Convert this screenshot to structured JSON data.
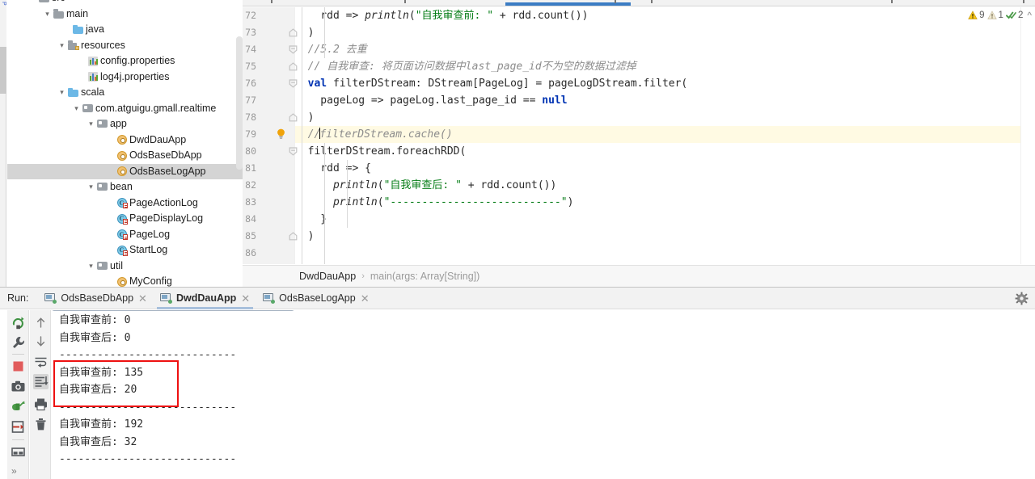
{
  "project_tree": {
    "items": [
      {
        "label": "src",
        "indent": 38,
        "icon": "folder-icon",
        "arrow": "",
        "selected": false,
        "partial": true
      },
      {
        "label": "main",
        "indent": 56,
        "icon": "folder-icon",
        "arrow": "v",
        "selected": false
      },
      {
        "label": "java",
        "indent": 80,
        "icon": "folder-blue-icon",
        "arrow": "",
        "selected": false
      },
      {
        "label": "resources",
        "indent": 74,
        "icon": "resources-folder-icon",
        "arrow": "v",
        "selected": false
      },
      {
        "label": "config.properties",
        "indent": 98,
        "icon": "properties-file-icon",
        "arrow": "",
        "selected": false
      },
      {
        "label": "log4j.properties",
        "indent": 98,
        "icon": "properties-file-icon",
        "arrow": "",
        "selected": false
      },
      {
        "label": "scala",
        "indent": 74,
        "icon": "folder-blue-icon",
        "arrow": "v",
        "selected": false
      },
      {
        "label": "com.atguigu.gmall.realtime",
        "indent": 92,
        "icon": "package-icon",
        "arrow": "v",
        "selected": false
      },
      {
        "label": "app",
        "indent": 110,
        "icon": "package-icon",
        "arrow": "v",
        "selected": false
      },
      {
        "label": "DwdDauApp",
        "indent": 134,
        "icon": "scala-object-icon",
        "arrow": "",
        "selected": false
      },
      {
        "label": "OdsBaseDbApp",
        "indent": 134,
        "icon": "scala-object-icon",
        "arrow": "",
        "selected": false
      },
      {
        "label": "OdsBaseLogApp",
        "indent": 134,
        "icon": "scala-object-icon",
        "arrow": "",
        "selected": true
      },
      {
        "label": "bean",
        "indent": 110,
        "icon": "package-icon",
        "arrow": "v",
        "selected": false
      },
      {
        "label": "PageActionLog",
        "indent": 134,
        "icon": "scala-class-icon",
        "arrow": "",
        "selected": false
      },
      {
        "label": "PageDisplayLog",
        "indent": 134,
        "icon": "scala-class-icon",
        "arrow": "",
        "selected": false
      },
      {
        "label": "PageLog",
        "indent": 134,
        "icon": "scala-class-icon",
        "arrow": "",
        "selected": false
      },
      {
        "label": "StartLog",
        "indent": 134,
        "icon": "scala-class-icon",
        "arrow": "",
        "selected": false
      },
      {
        "label": "util",
        "indent": 110,
        "icon": "package-icon",
        "arrow": "v",
        "selected": false
      },
      {
        "label": "MyConfig",
        "indent": 134,
        "icon": "scala-object-icon",
        "arrow": "",
        "selected": false,
        "partial": true
      }
    ]
  },
  "editor": {
    "first_line_number": 72,
    "lines": [
      {
        "n": 72,
        "fold": "",
        "html": "    rdd => <i>println</i>(<s>\"自我审查前: \"</s> + rdd.count())"
      },
      {
        "n": 73,
        "fold": "end",
        "html": "  )"
      },
      {
        "n": 74,
        "fold": "start",
        "html": "  <c>//5.2 去重</c>"
      },
      {
        "n": 75,
        "fold": "end",
        "html": "  <c>// 自我审查: 将页面访问数据中last_page_id不为空的数据过滤掉</c>"
      },
      {
        "n": 76,
        "fold": "start",
        "html": "  <k>val</k> filterDStream: DStream[PageLog] = pageLogDStream.filter("
      },
      {
        "n": 77,
        "fold": "",
        "html": "    pageLog => pageLog.last_page_id == <k>null</k>"
      },
      {
        "n": 78,
        "fold": "end",
        "html": "  )"
      },
      {
        "n": 79,
        "fold": "bulb",
        "html": "  <c>//</c><caret><c>filterDStream.cache()</c>",
        "highlight": true
      },
      {
        "n": 80,
        "fold": "start",
        "html": "  filterDStream.foreachRDD("
      },
      {
        "n": 81,
        "fold": "",
        "html": "    rdd => {"
      },
      {
        "n": 82,
        "fold": "",
        "html": "      <i>println</i>(<s>\"自我审查后: \"</s> + rdd.count())"
      },
      {
        "n": 83,
        "fold": "",
        "html": "      <i>println</i>(<s>\"---------------------------\"</s>)"
      },
      {
        "n": 84,
        "fold": "",
        "html": "    }"
      },
      {
        "n": 85,
        "fold": "end",
        "html": "  )"
      },
      {
        "n": 86,
        "fold": "",
        "html": ""
      }
    ],
    "inspections": {
      "warning_count": "9",
      "weak_warning_count": "1",
      "check_count": "2",
      "collapse_caret": "^"
    },
    "breadcrumb": {
      "class_name": "DwdDauApp",
      "separator": "›",
      "method_name": "main(args: Array[String])"
    }
  },
  "run_panel": {
    "label": "Run:",
    "tabs": [
      {
        "name": "OdsBaseDbApp",
        "active": false,
        "close": "✕"
      },
      {
        "name": "DwdDauApp",
        "active": true,
        "close": "✕"
      },
      {
        "name": "OdsBaseLogApp",
        "active": false,
        "close": "✕"
      }
    ],
    "settings_icon": "gear-icon",
    "toolbar_primary": [
      "rerun-icon",
      "wrench-settings-icon",
      "stop-icon",
      "camera-dump-icon",
      "export-threads-icon",
      "exit-icon",
      "layout-icon",
      "expand-more-icon"
    ],
    "toolbar_secondary": [
      "arrow-up-icon",
      "arrow-down-icon",
      "soft-wrap-icon",
      "scroll-to-end-icon",
      "print-icon",
      "trash-icon"
    ],
    "console": {
      "lines": [
        {
          "label": "自我审查前: ",
          "value": "0"
        },
        {
          "label": "自我审查后: ",
          "value": "0"
        },
        {
          "label": "----------------------------",
          "value": ""
        },
        {
          "label": "自我审查前: ",
          "value": "135"
        },
        {
          "label": "自我审查后: ",
          "value": "20"
        },
        {
          "label": "----------------------------",
          "value": ""
        },
        {
          "label": "自我审查前: ",
          "value": "192"
        },
        {
          "label": "自我审查后: ",
          "value": "32"
        },
        {
          "label": "----------------------------",
          "value": ""
        }
      ],
      "highlight_box_color": "#ee1111"
    }
  }
}
